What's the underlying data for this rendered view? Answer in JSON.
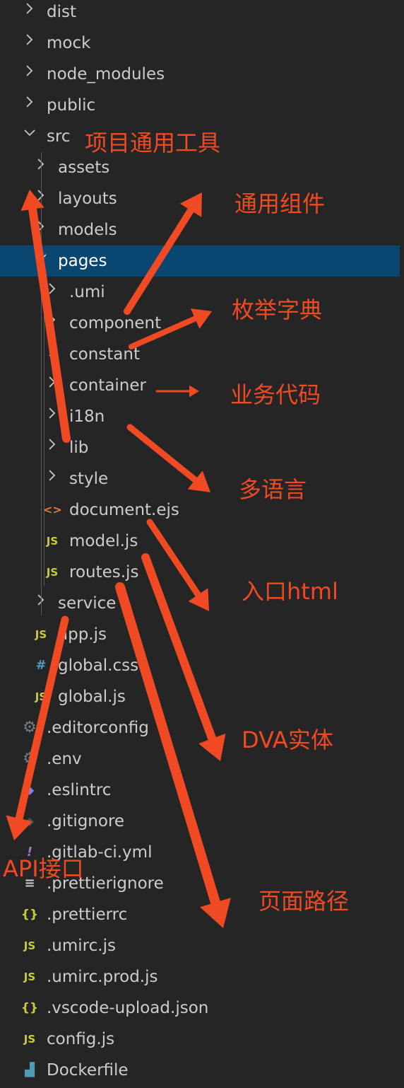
{
  "accent_color": "#f04a24",
  "selection_color": "#094771",
  "selected_item": "pages",
  "tree": [
    {
      "label": "dist",
      "icon": "chevron-right-icon",
      "depth": 0
    },
    {
      "label": "mock",
      "icon": "chevron-right-icon",
      "depth": 0
    },
    {
      "label": "node_modules",
      "icon": "chevron-right-icon",
      "depth": 0
    },
    {
      "label": "public",
      "icon": "chevron-right-icon",
      "depth": 0
    },
    {
      "label": "src",
      "icon": "chevron-down-icon",
      "depth": 0
    },
    {
      "label": "assets",
      "icon": "chevron-right-icon",
      "depth": 1
    },
    {
      "label": "layouts",
      "icon": "chevron-right-icon",
      "depth": 1
    },
    {
      "label": "models",
      "icon": "chevron-right-icon",
      "depth": 1
    },
    {
      "label": "pages",
      "icon": "chevron-down-icon",
      "depth": 1
    },
    {
      "label": ".umi",
      "icon": "chevron-right-icon",
      "depth": 2
    },
    {
      "label": "component",
      "icon": "chevron-right-icon",
      "depth": 2
    },
    {
      "label": "constant",
      "icon": "chevron-right-icon",
      "depth": 2
    },
    {
      "label": "container",
      "icon": "chevron-right-icon",
      "depth": 2
    },
    {
      "label": "i18n",
      "icon": "chevron-right-icon",
      "depth": 2
    },
    {
      "label": "lib",
      "icon": "chevron-right-icon",
      "depth": 2
    },
    {
      "label": "style",
      "icon": "chevron-right-icon",
      "depth": 2
    },
    {
      "label": "document.ejs",
      "icon": "html-file-icon",
      "depth": 2
    },
    {
      "label": "model.js",
      "icon": "js-file-icon",
      "depth": 2
    },
    {
      "label": "routes.js",
      "icon": "js-file-icon",
      "depth": 2
    },
    {
      "label": "service",
      "icon": "chevron-right-icon",
      "depth": 1
    },
    {
      "label": "app.js",
      "icon": "js-file-icon",
      "depth": 1
    },
    {
      "label": "global.css",
      "icon": "css-file-icon",
      "depth": 1
    },
    {
      "label": "global.js",
      "icon": "js-file-icon",
      "depth": 1
    },
    {
      "label": ".editorconfig",
      "icon": "gear-icon",
      "depth": 0
    },
    {
      "label": ".env",
      "icon": "gear-icon",
      "depth": 0
    },
    {
      "label": ".eslintrc",
      "icon": "eslint-icon",
      "depth": 0
    },
    {
      "label": ".gitignore",
      "icon": "git-icon",
      "depth": 0
    },
    {
      "label": ".gitlab-ci.yml",
      "icon": "yaml-icon",
      "depth": 0
    },
    {
      "label": ".prettierignore",
      "icon": "lines-icon",
      "depth": 0
    },
    {
      "label": ".prettierrc",
      "icon": "json-braces-icon",
      "depth": 0
    },
    {
      "label": ".umirc.js",
      "icon": "js-file-icon",
      "depth": 0
    },
    {
      "label": ".umirc.prod.js",
      "icon": "js-file-icon",
      "depth": 0
    },
    {
      "label": ".vscode-upload.json",
      "icon": "json-braces-icon",
      "depth": 0
    },
    {
      "label": "config.js",
      "icon": "js-file-icon",
      "depth": 0
    },
    {
      "label": "Dockerfile",
      "icon": "docker-icon",
      "depth": 0
    }
  ],
  "annotations": [
    "项目通用工具",
    "通用组件",
    "枚举字典",
    "业务代码",
    "多语言",
    "入口html",
    "DVA实体",
    "API接口",
    "页面路径"
  ]
}
